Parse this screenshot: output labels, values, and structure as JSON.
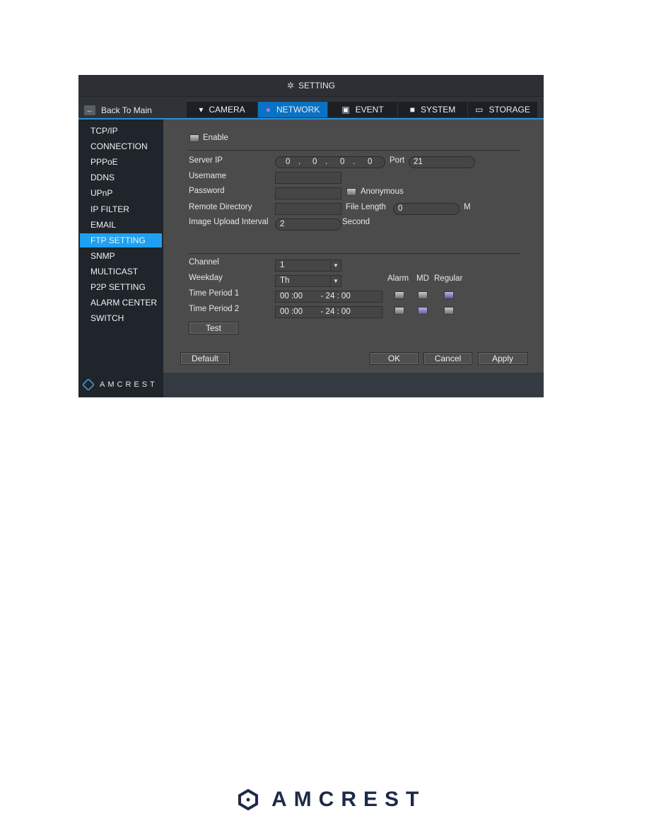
{
  "window": {
    "title": "SETTING",
    "title_icon": "gear-icon"
  },
  "back_button": {
    "label": "Back To Main",
    "icon": "back-arrow-icon"
  },
  "tabs": [
    {
      "label": "CAMERA",
      "icon": "camera-icon",
      "active": false
    },
    {
      "label": "NETWORK",
      "icon": "globe-icon",
      "active": true
    },
    {
      "label": "EVENT",
      "icon": "event-icon",
      "active": false
    },
    {
      "label": "SYSTEM",
      "icon": "system-icon",
      "active": false
    },
    {
      "label": "STORAGE",
      "icon": "storage-icon",
      "active": false
    }
  ],
  "sidebar": {
    "items": [
      {
        "label": "TCP/IP"
      },
      {
        "label": "CONNECTION"
      },
      {
        "label": "PPPoE"
      },
      {
        "label": "DDNS"
      },
      {
        "label": "UPnP"
      },
      {
        "label": "IP FILTER"
      },
      {
        "label": "EMAIL"
      },
      {
        "label": "FTP SETTING",
        "active": true
      },
      {
        "label": "SNMP"
      },
      {
        "label": "MULTICAST"
      },
      {
        "label": "P2P SETTING"
      },
      {
        "label": "ALARM CENTER"
      },
      {
        "label": "SWITCH"
      }
    ],
    "brand": "AMCREST"
  },
  "form": {
    "enable_label": "Enable",
    "server_ip_label": "Server IP",
    "server_ip": [
      "0",
      "0",
      "0",
      "0"
    ],
    "port_label": "Port",
    "port_value": "21",
    "username_label": "Username",
    "username_value": "",
    "password_label": "Password",
    "password_value": "",
    "anonymous_label": "Anonymous",
    "remote_dir_label": "Remote Directory",
    "remote_dir_value": "",
    "file_length_label": "File Length",
    "file_length_value": "0",
    "file_length_unit": "M",
    "upload_interval_label": "Image Upload Interval",
    "upload_interval_value": "2",
    "upload_interval_unit": "Second",
    "channel_label": "Channel",
    "channel_value": "1",
    "weekday_label": "Weekday",
    "weekday_value": "Th",
    "col_alarm": "Alarm",
    "col_md": "MD",
    "col_regular": "Regular",
    "period1_label": "Time Period 1",
    "period1_value": "00 :00        - 24 : 00",
    "period2_label": "Time Period 2",
    "period2_value": "00 :00        - 24 : 00",
    "test_label": "Test"
  },
  "buttons": {
    "default": "Default",
    "ok": "OK",
    "cancel": "Cancel",
    "apply": "Apply"
  },
  "page_brand": "AMCREST",
  "colors": {
    "accent": "#0a72c2",
    "sidebar_active": "#1ea1f2",
    "brand_navy": "#1e2a48"
  }
}
